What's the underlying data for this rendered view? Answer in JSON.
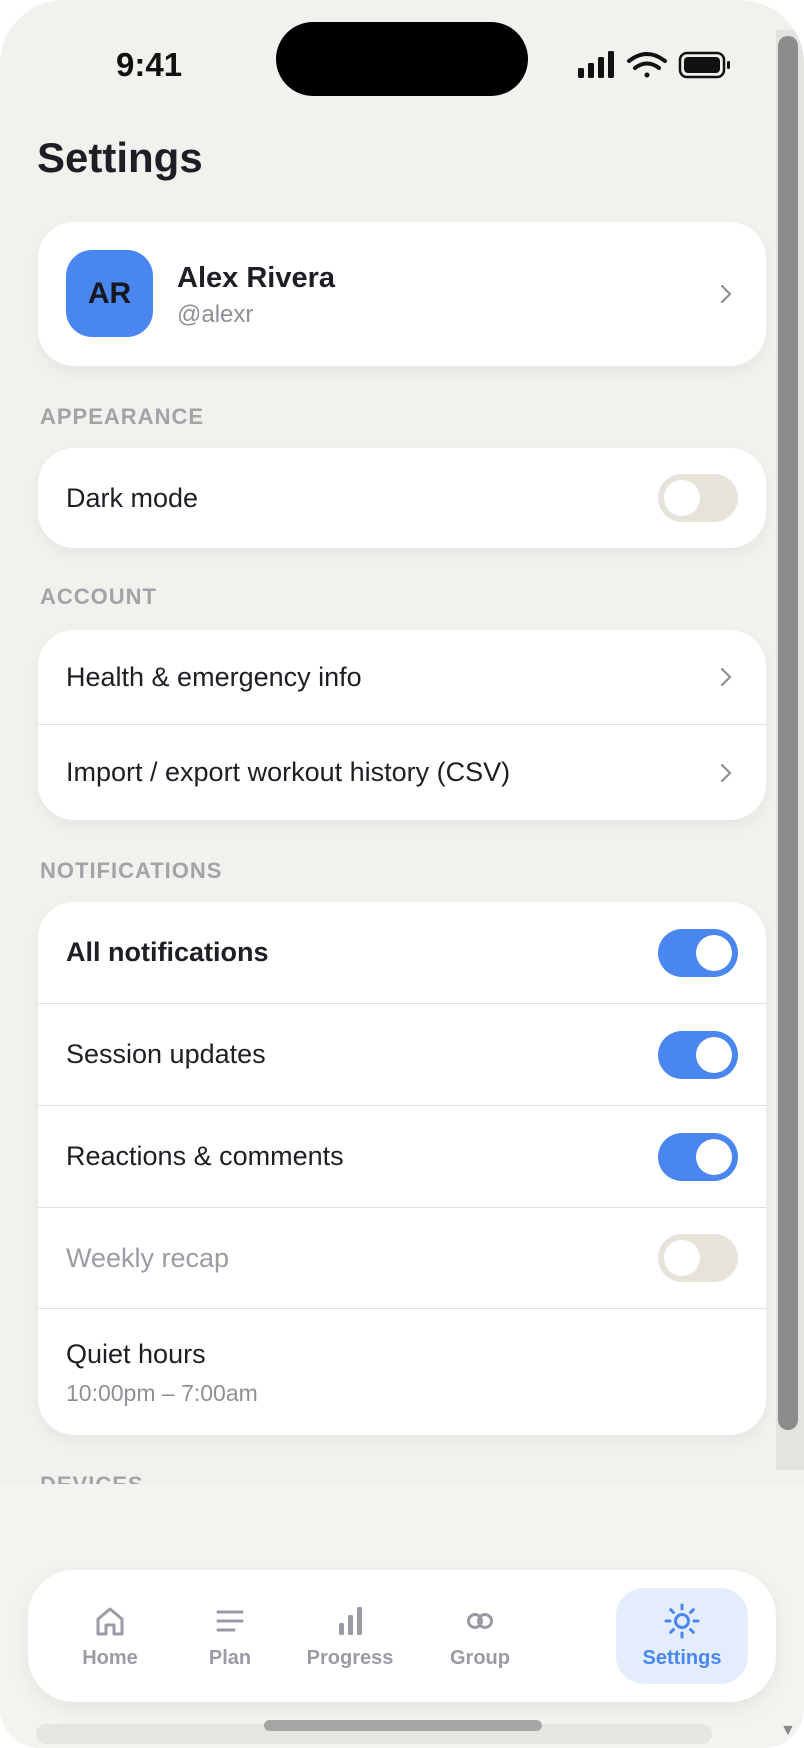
{
  "status_bar": {
    "time": "9:41"
  },
  "page": {
    "title": "Settings"
  },
  "profile": {
    "initials": "AR",
    "name": "Alex Rivera",
    "handle": "@alexr"
  },
  "sections": {
    "appearance": "APPEARANCE",
    "account": "ACCOUNT",
    "notifications": "NOTIFICATIONS",
    "devices": "DEVICES"
  },
  "appearance": {
    "dark_mode": {
      "label": "Dark mode",
      "on": false
    }
  },
  "account": {
    "items": [
      {
        "label": "Health & emergency info"
      },
      {
        "label": "Import / export workout history (CSV)"
      }
    ]
  },
  "notifications": {
    "all": {
      "label": "All notifications",
      "on": true
    },
    "session_updates": {
      "label": "Session updates",
      "on": true
    },
    "reactions": {
      "label": "Reactions & comments",
      "on": true
    },
    "weekly_recap": {
      "label": "Weekly recap",
      "on": false
    },
    "quiet_hours": {
      "label": "Quiet hours",
      "value": "10:00pm – 7:00am"
    }
  },
  "tabbar": {
    "tabs": [
      {
        "label": "Home",
        "icon": "home-icon"
      },
      {
        "label": "Plan",
        "icon": "list-icon"
      },
      {
        "label": "Progress",
        "icon": "bar-chart-icon"
      },
      {
        "label": "Group",
        "icon": "group-icon"
      },
      {
        "label": "Settings",
        "icon": "sun-icon",
        "active": true
      }
    ]
  },
  "colors": {
    "accent": "#4a86f0",
    "background": "#f2f1ee",
    "card": "#ffffff"
  }
}
